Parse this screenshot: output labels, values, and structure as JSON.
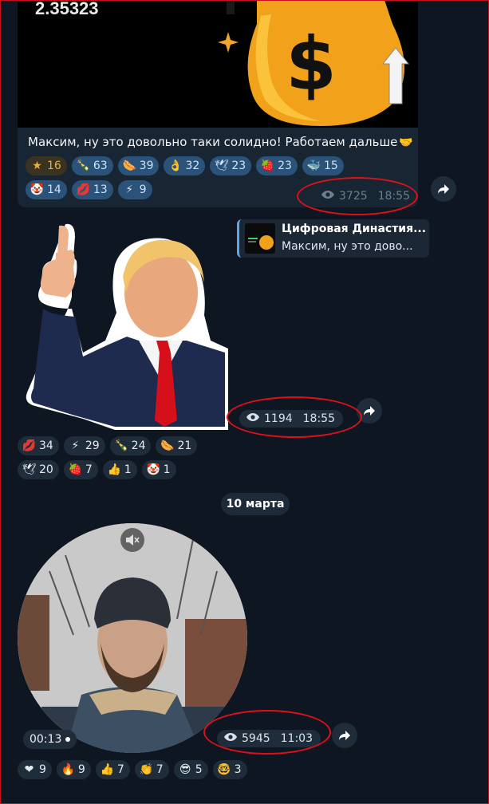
{
  "message1": {
    "price": "2.35323",
    "caption": "Максим, ну это довольно таки солидно! Работаем дальше",
    "caption_emoji": "handshake-icon",
    "reactions": [
      {
        "icon": "star-icon",
        "glyph": "★",
        "count": "16",
        "kind": "star"
      },
      {
        "icon": "champagne-icon",
        "glyph": "🍾",
        "count": "63"
      },
      {
        "icon": "hotdog-icon",
        "glyph": "🌭",
        "count": "39"
      },
      {
        "icon": "ok-hand-icon",
        "glyph": "👌",
        "count": "32"
      },
      {
        "icon": "dove-icon",
        "glyph": "🕊",
        "count": "23"
      },
      {
        "icon": "strawberry-icon",
        "glyph": "🍓",
        "count": "23"
      },
      {
        "icon": "whale-icon",
        "glyph": "🐳",
        "count": "15"
      },
      {
        "icon": "clown-icon",
        "glyph": "🤡",
        "count": "14"
      },
      {
        "icon": "kiss-icon",
        "glyph": "💋",
        "count": "13"
      },
      {
        "icon": "lightning-icon",
        "glyph": "⚡",
        "count": "9"
      }
    ],
    "views": "3725",
    "time": "18:55"
  },
  "message2": {
    "reply_title": "Цифровая Династия...",
    "reply_text": "Максим, ну это дово...",
    "views": "1194",
    "time": "18:55",
    "reactions": [
      {
        "icon": "kiss-icon",
        "glyph": "💋",
        "count": "34"
      },
      {
        "icon": "lightning-icon",
        "glyph": "⚡",
        "count": "29"
      },
      {
        "icon": "champagne-icon",
        "glyph": "🍾",
        "count": "24"
      },
      {
        "icon": "hotdog-icon",
        "glyph": "🌭",
        "count": "21"
      },
      {
        "icon": "dove-icon",
        "glyph": "🕊",
        "count": "20"
      },
      {
        "icon": "strawberry-icon",
        "glyph": "🍓",
        "count": "7"
      },
      {
        "icon": "thumbs-up-icon",
        "glyph": "👍",
        "count": "1"
      },
      {
        "icon": "clown-icon",
        "glyph": "🤡",
        "count": "1"
      }
    ]
  },
  "date_separator": "10 марта",
  "message3": {
    "duration": "00:13",
    "views": "5945",
    "time": "11:03",
    "reactions": [
      {
        "icon": "heart-icon",
        "glyph": "❤",
        "count": "9"
      },
      {
        "icon": "fire-icon",
        "glyph": "🔥",
        "count": "9"
      },
      {
        "icon": "thumbs-up-icon",
        "glyph": "👍",
        "count": "7"
      },
      {
        "icon": "clapping-icon",
        "glyph": "👏",
        "count": "7"
      },
      {
        "icon": "cool-face-icon",
        "glyph": "😎",
        "count": "5"
      },
      {
        "icon": "nerd-face-icon",
        "glyph": "🤓",
        "count": "3"
      }
    ]
  },
  "colors": {
    "background": "#0e1621",
    "bubble": "#182533",
    "reaction_pill": "#2b5278",
    "annotation": "#e0101a"
  }
}
